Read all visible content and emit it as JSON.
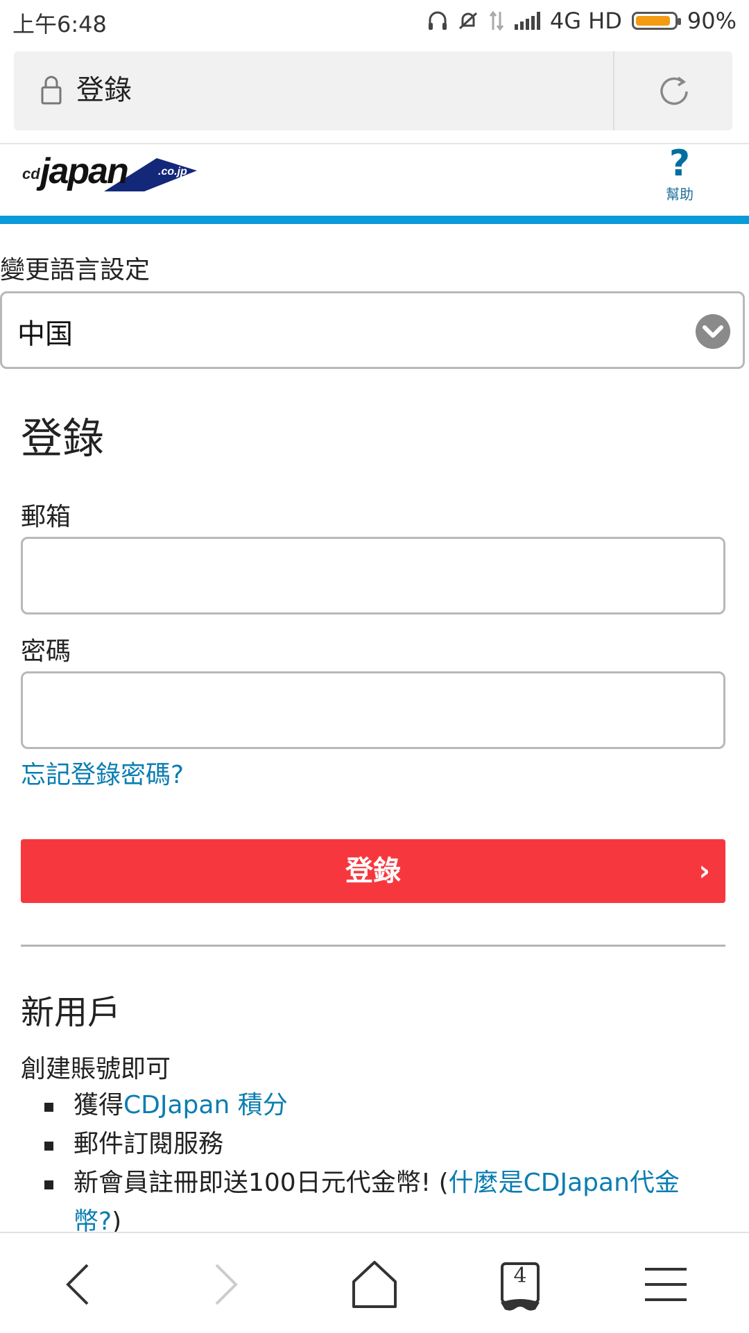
{
  "status_bar": {
    "time": "上午6:48",
    "network": "4G HD",
    "battery": "90%",
    "battery_level": 0.9
  },
  "browser": {
    "page_title": "登錄",
    "lock_icon": "lock-icon",
    "reload_icon": "reload-icon"
  },
  "header": {
    "logo_text": "cdjapan",
    "logo_suffix": ".co.jp",
    "help_label": "幫助"
  },
  "language": {
    "label": "變更語言設定",
    "selected": "中国"
  },
  "login": {
    "title": "登錄",
    "email_label": "郵箱",
    "email_value": "",
    "password_label": "密碼",
    "password_value": "",
    "forgot_link": "忘記登錄密碼?",
    "submit_label": "登錄",
    "submit_arrow": "›"
  },
  "new_user": {
    "title": "新用戶",
    "intro": "創建賬號即可",
    "bullets": [
      {
        "text": "獲得",
        "link": "CDJapan 積分"
      },
      {
        "text": "郵件訂閱服務"
      },
      {
        "text": "新會員註冊即送100日元代金幣! (",
        "link": "什麼是CDJapan代金幣?",
        "suffix": ")"
      }
    ]
  },
  "bottom_nav": {
    "tab_count": "4",
    "items": [
      "back",
      "forward",
      "home",
      "tabs",
      "menu"
    ]
  },
  "colors": {
    "accent_blue": "#0a9bd8",
    "link_blue": "#0a7db1",
    "login_red": "#f6383e"
  }
}
